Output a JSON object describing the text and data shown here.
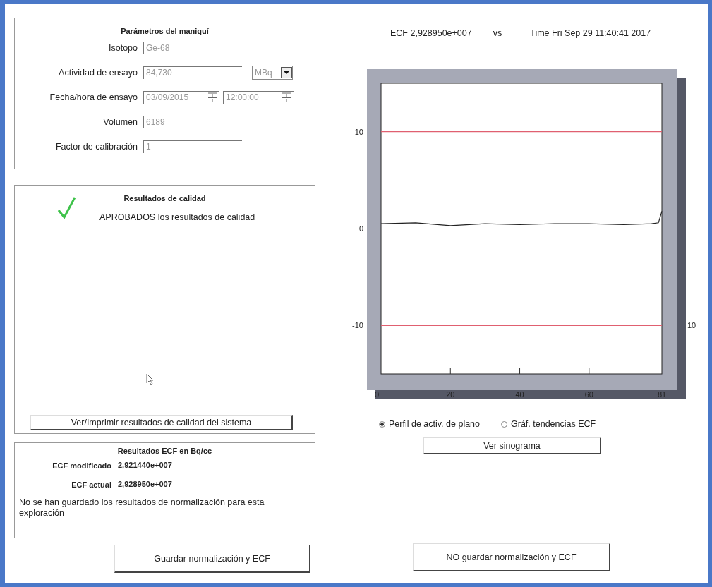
{
  "phantom_panel": {
    "title": "Parámetros del maniquí",
    "fields": [
      {
        "kind": "text",
        "label": "Isotopo",
        "value": "Ge-68",
        "disabled": true
      },
      {
        "kind": "unit",
        "label": "Actividad de ensayo",
        "value": "84,730",
        "unit": "MBq",
        "disabled": true
      },
      {
        "kind": "datetime",
        "label": "Fecha/hora de ensayo",
        "value": "03/09/2015",
        "time": "12:00:00",
        "disabled": true
      },
      {
        "kind": "text",
        "label": "Volumen",
        "value": "6189",
        "disabled": true
      },
      {
        "kind": "text",
        "label": "Factor de calibración",
        "value": "1",
        "disabled": true
      }
    ]
  },
  "quality_panel": {
    "title": "Resultados de calidad",
    "passed": true,
    "message": "APROBADOS los resultados de calidad",
    "button": "Ver/Imprimir resultados de calidad del sistema"
  },
  "ecf_panel": {
    "title": "Resultados ECF en Bq/cc",
    "fields": [
      {
        "label": "ECF modificado",
        "value": "2,921440e+007"
      },
      {
        "label": "ECF actual",
        "value": "2,928950e+007"
      }
    ],
    "note": "No se han guardado los resultados de normalización para esta exploración"
  },
  "chart_header": {
    "ecf": "ECF 2,928950e+007",
    "vs": "vs",
    "time": "Time Fri Sep 29 11:40:41 2017"
  },
  "chart_data": {
    "type": "line",
    "x": [
      0,
      10,
      20,
      30,
      40,
      50,
      60,
      70,
      78,
      80,
      81
    ],
    "xlim": [
      0,
      81
    ],
    "ylim": [
      -15,
      15
    ],
    "xticks": [
      0,
      20,
      40,
      60,
      81
    ],
    "yticks": [
      -10,
      0,
      10
    ],
    "series": [
      {
        "color": "#e06070",
        "values": [
          10,
          10,
          10,
          10,
          10,
          10,
          10,
          10,
          10,
          10,
          10
        ]
      },
      {
        "color": "#222222",
        "values": [
          0.5,
          0.6,
          0.3,
          0.5,
          0.4,
          0.5,
          0.5,
          0.4,
          0.5,
          0.6,
          1.8
        ]
      },
      {
        "color": "#e06070",
        "values": [
          -10,
          -10,
          -10,
          -10,
          -10,
          -10,
          -10,
          -10,
          -10,
          -10,
          -10
        ]
      }
    ]
  },
  "right_axis_label": "10",
  "views": [
    {
      "label": "Perfil de activ. de plano",
      "selected": true
    },
    {
      "label": "Gráf. tendencias ECF",
      "selected": false
    }
  ],
  "sinogram_button": "Ver sinograma",
  "buttons": [
    "Guardar normalización y ECF",
    "NO guardar normalización y ECF"
  ]
}
